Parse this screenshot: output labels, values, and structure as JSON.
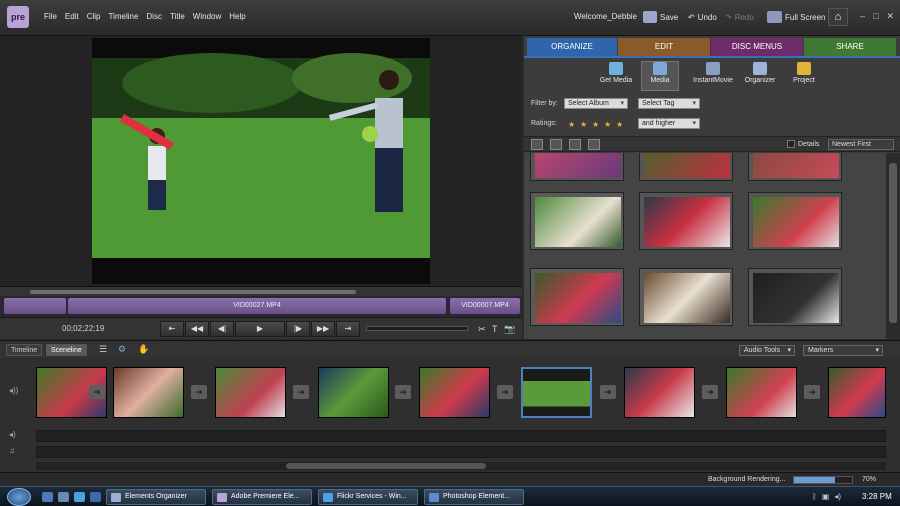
{
  "app": {
    "logo_text": "pre",
    "menu": [
      "File",
      "Edit",
      "Clip",
      "Timeline",
      "Disc",
      "Title",
      "Window",
      "Help"
    ],
    "welcome": "Welcome_Debbie",
    "save_label": "Save",
    "undo_label": "Undo",
    "redo_label": "Redo",
    "fullscreen_label": "Full Screen",
    "window_controls": [
      "–",
      "□",
      "✕"
    ]
  },
  "monitor": {
    "clips": [
      "VID00027.MP4",
      "VID00007.MP4"
    ],
    "timecode": "00;02;22;19",
    "controls": [
      "⇤",
      "◀◀",
      "◀|",
      "▶",
      "|▶",
      "▶▶",
      "⇥"
    ],
    "tools": [
      "✂",
      "T",
      "📷"
    ]
  },
  "panel": {
    "tabs": [
      {
        "label": "ORGANIZE",
        "color": "#2f65ab"
      },
      {
        "label": "EDIT",
        "color": "#8a5a2a"
      },
      {
        "label": "DISC MENUS",
        "color": "#6d2b6a"
      },
      {
        "label": "SHARE",
        "color": "#3f7a35"
      }
    ],
    "subtabs": [
      "Get Media",
      "Media",
      "InstantMovie",
      "Organizer",
      "Project"
    ],
    "filter_label": "Filter by:",
    "select_album": "Select Album",
    "select_tag": "Select Tag",
    "ratings_label": "Ratings:",
    "ratings_stars": "★",
    "ratings_mode": "and higher",
    "details_label": "Details",
    "sort": "Newest First"
  },
  "sceneline": {
    "tabs": [
      "Timeline",
      "Sceneline"
    ],
    "audio_tools": "Audio Tools",
    "markers": "Markers",
    "scene_count": 9
  },
  "status": {
    "rendering_label": "Background Rendering...",
    "progress": 0.7,
    "progress_text": "70%"
  },
  "taskbar": {
    "tasks": [
      "Elements Organizer",
      "Adobe Premiere Ele...",
      "Flickr Services - Win...",
      "Photoshop Element..."
    ],
    "clock": "3:28 PM"
  }
}
